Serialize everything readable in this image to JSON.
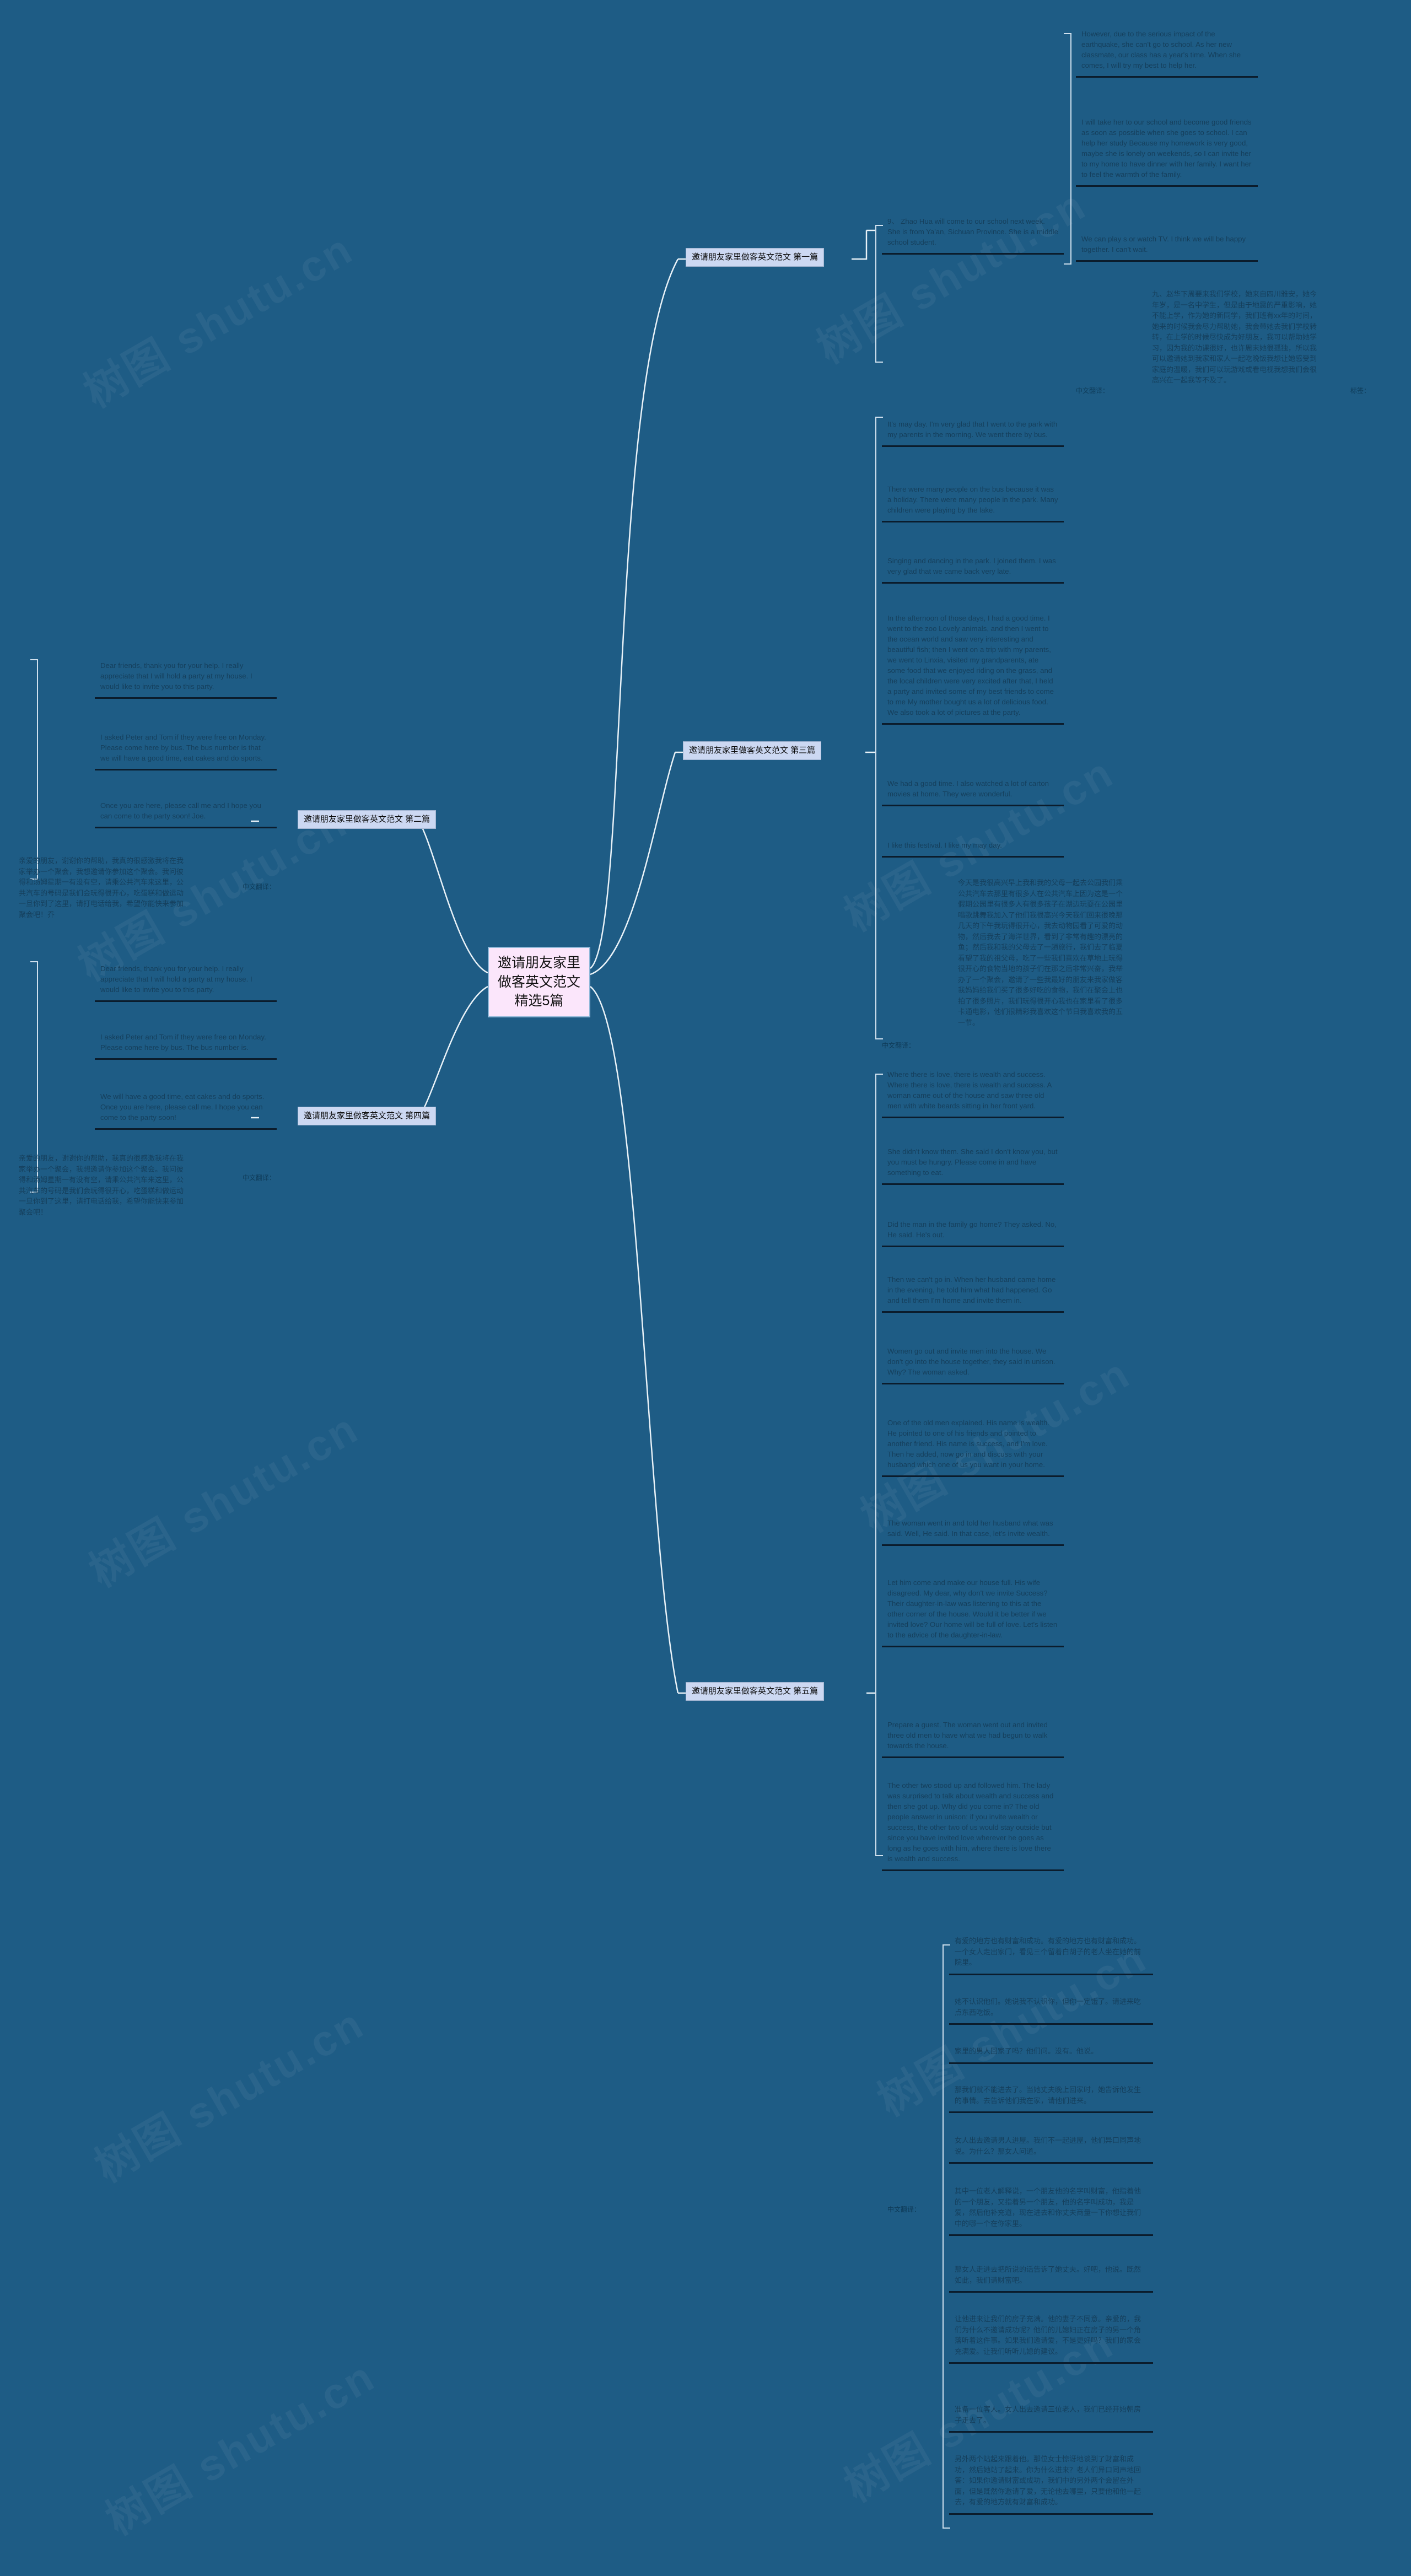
{
  "meta": {
    "background_color": "#1e5c85",
    "root_fill": "#fbe6fb",
    "branch_fill": "#ccd8f2",
    "text_color": "#153f5c",
    "watermark_text": "树图 shutu.cn"
  },
  "root": {
    "title": "邀请朋友家里做客英文范文精选5篇"
  },
  "branches": [
    {
      "id": "b1",
      "label": "邀请朋友家里做客英文范文 第一篇"
    },
    {
      "id": "b2",
      "label": "邀请朋友家里做客英文范文 第二篇"
    },
    {
      "id": "b3",
      "label": "邀请朋友家里做客英文范文 第三篇"
    },
    {
      "id": "b4",
      "label": "邀请朋友家里做客英文范文 第四篇"
    },
    {
      "id": "b5",
      "label": "邀请朋友家里做客英文范文 第五篇"
    }
  ],
  "b1_leaves": [
    {
      "text": "9、 Zhao Hua will come to our school next week. She is from Ya'an, Sichuan Province. She is a middle school student."
    },
    {
      "text": "However, due to the serious impact of the earthquake, she can't go to school. As her new classmate, our class has a year's time. When she comes, I will try my best to help her."
    },
    {
      "text": "I will take her to our school and become good friends as soon as possible when she goes to school. I can help her study Because my homework is very good, maybe she is lonely on weekends, so I can invite her to my home to have dinner with her family. I want her to feel the warmth of the family."
    },
    {
      "text": "We can play s or watch TV. I think we will be happy together. I can't wait."
    }
  ],
  "b1_cn": {
    "label": "中文翻译：",
    "tag_label": "标签：",
    "text": "九、赵华下周要来我们学校，她来自四川雅安，她今年岁，是一名中学生，但是由于地震的严重影响，她不能上学，作为她的新同学，我们班有xx年的时间，她来的时候我会尽力帮助她，我会带她去我们学校转转，在上学的时候尽快成为好朋友，我可以帮助她学习，因为我的功课很好，也许周末她很孤独，所以我可以邀请她到我家和家人一起吃晚饭我想让她感受到家庭的温暖，我们可以玩游戏或看电视我想我们会很高兴在一起我等不及了。"
  },
  "b2_leaves": [
    {
      "text": "Dear friends, thank you for your help. I really appreciate that I will hold a party at my house. I would like to invite you to this party."
    },
    {
      "text": "I asked Peter and Tom if they were free on Monday. Please come here by bus. The bus number is that we will have a good time, eat cakes and do sports."
    },
    {
      "text": "Once you are here, please call me and I hope you can come to the party soon! Joe."
    }
  ],
  "b2_cn": {
    "label": "中文翻译：",
    "text": "亲爱的朋友，谢谢你的帮助，我真的很感激我将在我家举办一个聚会，我想邀请你参加这个聚会。我问彼得和汤姆星期一有没有空，请乘公共汽车来这里，公共汽车的号码是我们会玩得很开心，吃蛋糕和做运动一旦你到了这里，请打电话给我，希望你能快来参加聚会吧！乔"
  },
  "b3_leaves": [
    {
      "text": "It's may day. I'm very glad that I went to the park with my parents in the morning. We went there by bus."
    },
    {
      "text": "There were many people on the bus because it was a holiday. There were many people in the park. Many children were playing by the lake."
    },
    {
      "text": "Singing and dancing in the park. I joined them. I was very glad that we came back very late."
    },
    {
      "text": "In the afternoon of those days, I had a good time. I went to the zoo Lovely animals, and then I went to the ocean world and saw very interesting and beautiful fish; then I went on a trip with my parents, we went to Linxia, visited my grandparents, ate some food that we enjoyed riding on the grass, and the local children were very excited after that, I held a party and invited some of my best friends to come to me My mother bought us a lot of delicious food. We also took a lot of pictures at the party."
    },
    {
      "text": "We had a good time. I also watched a lot of carton movies at home. They were wonderful."
    },
    {
      "text": "I like this festival. I like my may day."
    }
  ],
  "b3_cn": {
    "label": "中文翻译：",
    "text": "今天是我很高兴早上我和我的父母一起去公园我们乘公共汽车去那里有很多人在公共汽车上因为这是一个假期公园里有很多人有很多孩子在湖边玩耍在公园里唱歌跳舞我加入了他们我很高兴今天我们回来很晚那几天的下午我玩得很开心，我去动物园看了可爱的动物，然后我去了海洋世界，看到了非常有趣的漂亮的鱼；然后我和我的父母去了一趟旅行，我们去了临夏看望了我的祖父母，吃了一些我们喜欢在草地上玩得很开心的食物当地的孩子们在那之后非常兴奋，我举办了一个聚会，邀请了一些我最好的朋友来我家做客我妈妈给我们买了很多好吃的食物，我们在聚会上也拍了很多照片，我们玩得很开心我也在家里看了很多卡通电影，他们很精彩我喜欢这个节日我喜欢我的五一节。"
  },
  "b4_leaves": [
    {
      "text": "Dear friends, thank you for your help. I really appreciate that I will hold a party at my house. I would like to invite you to this party."
    },
    {
      "text": "I asked Peter and Tom if they were free on Monday. Please come here by bus. The bus number is."
    },
    {
      "text": "We will have a good time, eat cakes and do sports. Once you are here, please call me. I hope you can come to the party soon!"
    }
  ],
  "b4_cn": {
    "label": "中文翻译：",
    "text": "亲爱的朋友，谢谢你的帮助，我真的很感激我将在我家举办一个聚会，我想邀请你参加这个聚会。我问彼得和汤姆星期一有没有空，请乘公共汽车来这里，公共汽车的号码是我们会玩得很开心，吃蛋糕和做运动一旦你到了这里，请打电话给我，希望你能快来参加聚会吧！"
  },
  "b5_leaves": [
    {
      "text": "Where there is love, there is wealth and success. Where there is love, there is wealth and success. A woman came out of the house and saw three old men with white beards sitting in her front yard."
    },
    {
      "text": "She didn't know them. She said I don't know you, but you must be hungry. Please come in and have something to eat."
    },
    {
      "text": "Did the man in the family go home? They asked. No, He said. He's out."
    },
    {
      "text": "Then we can't go in. When her husband came home in the evening, he told him what had happened. Go and tell them I'm home and invite them in."
    },
    {
      "text": "Women go out and invite men into the house. We don't go into the house together, they said in unison. Why? The woman asked."
    },
    {
      "text": "One of the old men explained. His name is wealth. He pointed to one of his friends and pointed to another friend. His name is success, and I'm love. Then he added, now go in and discuss with your husband which one of us you want in your home."
    },
    {
      "text": "The woman went in and told her husband what was said. Well, He said. In that case, let's invite wealth."
    },
    {
      "text": "Let him come and make our house full. His wife disagreed. My dear, why don't we invite Success? Their daughter-in-law was listening to this at the other corner of the house. Would it be better if we invited love? Our home will be full of love. Let's listen to the advice of the daughter-in-law."
    },
    {
      "text": "Prepare a guest. The woman went out and invited three old men to have what we had begun to walk towards the house."
    },
    {
      "text": "The other two stood up and followed him. The lady was surprised to talk about wealth and success and then she got up. Why did you come in? The old people answer in unison: if you invite wealth or success, the other two of us would stay outside but since you have invited love wherever he goes as long as he goes with him, where there is love there is wealth and success."
    }
  ],
  "b5_cn": {
    "label": "中文翻译：",
    "text": "有爱的地方也有财富和成功。有爱的地方也有财富和成功。一个女人走出家门，看见三个留着白胡子的老人坐在她的前院里。",
    "parts": [
      "有爱的地方也有财富和成功。有爱的地方也有财富和成功。一个女人走出家门，看见三个留着白胡子的老人坐在她的前院里。",
      "她不认识他们。她说我不认识你，但你一定饿了。请进来吃点东西吃饭。",
      "家里的男人回家了吗？他们问。没有。他说。",
      "那我们就不能进去了。当她丈夫晚上回家时，她告诉他发生的事情。去告诉他们我在家，请他们进来。",
      "女人出去邀请男人进屋。我们不一起进屋，他们异口同声地说。为什么？那女人问道。",
      "其中一位老人解释说，一个朋友他的名字叫财富，他指着他的一个朋友，又指着另一个朋友，他的名字叫成功，我是爱，然后他补充道，现在进去和你丈夫商量一下你想让我们中的哪一个在你家里。",
      "那女人走进去把所说的话告诉了她丈夫。好吧，他说。既然如此，我们请财富吧。",
      "让他进来让我们的房子充满。他的妻子不同意。亲爱的，我们为什么不邀请成功呢？他们的儿媳妇正在房子的另一个角落听着这件事。如果我们邀请爱，不是更好吗？我们的家会充满爱。让我们听听儿媳的建议。",
      "准备一位客人。女人出去邀请三位老人，我们已经开始朝房子走去了。",
      "另外两个站起来跟着他。那位女士惊讶地谈到了财富和成功，然后她站了起来。你为什么进来？老人们异口同声地回答：如果你邀请财富或成功，我们中的另外两个会留在外面，但是既然你邀请了爱，无论他去哪里，只要他和他一起去，有爱的地方就有财富和成功。"
    ]
  }
}
